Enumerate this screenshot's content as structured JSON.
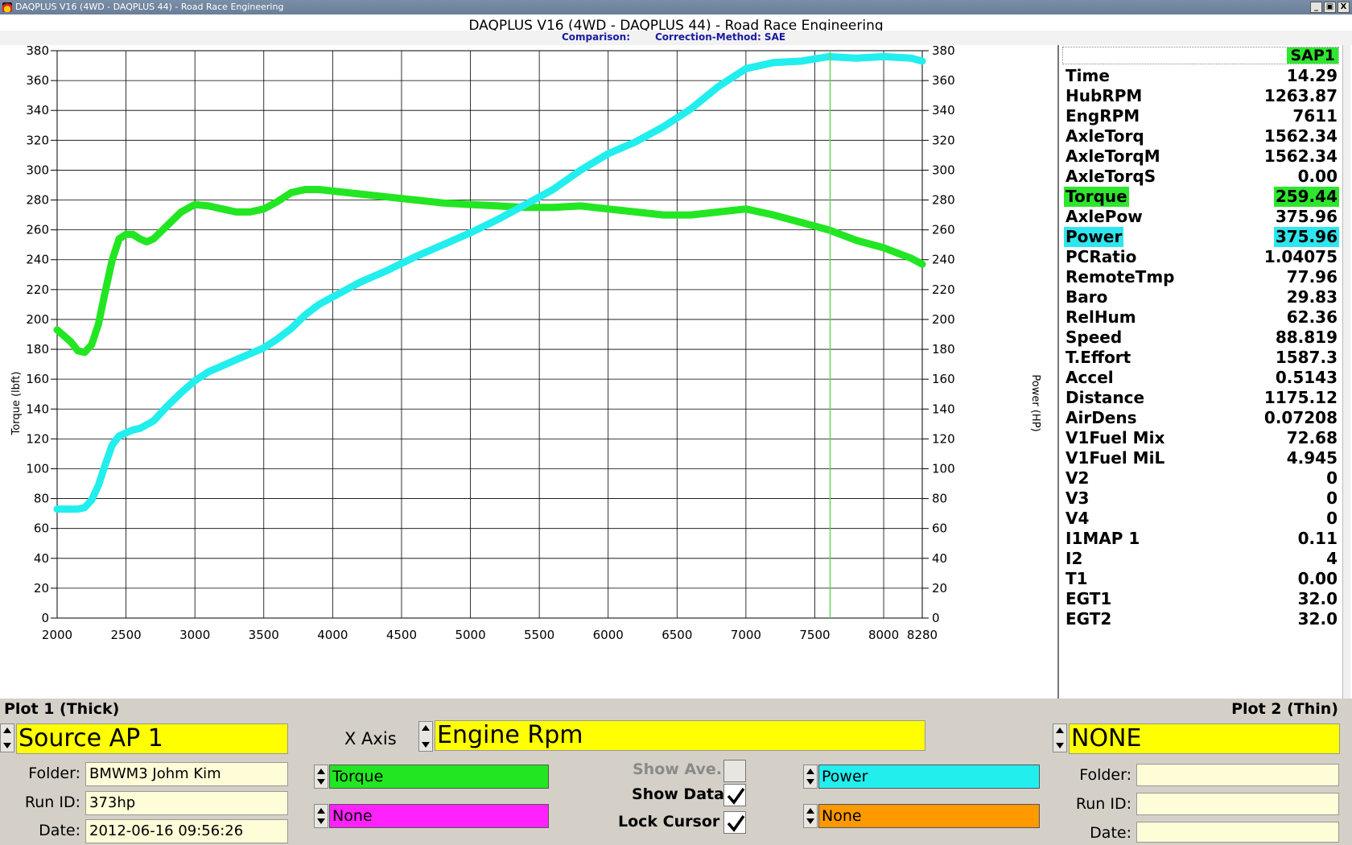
{
  "window": {
    "title": "DAQPLUS V16 (4WD - DAQPLUS 44) - Road Race Engineering",
    "minimize_label": "_",
    "restore_label": "▣",
    "close_label": "X"
  },
  "chart_header": {
    "title": "DAQPLUS V16 (4WD - DAQPLUS 44) - Road Race Engineering",
    "comparison_label": "Comparison:",
    "correction_label": "Correction-Method: SAE"
  },
  "chart_data": {
    "type": "line",
    "xlabel": "",
    "ylabel": "Torque (lbft)",
    "y2label": "Power (HP)",
    "xlim": [
      2000,
      8280
    ],
    "ylim": [
      0,
      380
    ],
    "y2lim": [
      0,
      380
    ],
    "x_ticks": [
      2000,
      2500,
      3000,
      3500,
      4000,
      4500,
      5000,
      5500,
      6000,
      6500,
      7000,
      7500,
      8000,
      8280
    ],
    "y_ticks": [
      0,
      20,
      40,
      60,
      80,
      100,
      120,
      140,
      160,
      180,
      200,
      220,
      240,
      260,
      280,
      300,
      320,
      340,
      360,
      380
    ],
    "grid": true,
    "cursor_x": 7611,
    "series": [
      {
        "name": "Torque",
        "color": "#22e622",
        "axis": "left",
        "x": [
          2000,
          2100,
          2150,
          2200,
          2250,
          2300,
          2350,
          2400,
          2450,
          2500,
          2550,
          2600,
          2650,
          2700,
          2800,
          2900,
          3000,
          3100,
          3200,
          3300,
          3400,
          3500,
          3600,
          3700,
          3800,
          3900,
          4000,
          4200,
          4400,
          4600,
          4800,
          5000,
          5200,
          5400,
          5600,
          5800,
          6000,
          6200,
          6400,
          6600,
          6800,
          7000,
          7200,
          7400,
          7600,
          7800,
          8000,
          8200,
          8280
        ],
        "values": [
          193,
          185,
          179,
          178,
          183,
          197,
          219,
          240,
          254,
          257,
          257,
          254,
          252,
          254,
          263,
          272,
          277,
          276,
          274,
          272,
          272,
          274,
          279,
          285,
          287,
          287,
          286,
          284,
          282,
          280,
          278,
          277,
          276,
          275,
          275,
          276,
          274,
          272,
          270,
          270,
          272,
          274,
          270,
          265,
          260,
          253,
          248,
          241,
          237
        ]
      },
      {
        "name": "Power",
        "color": "#22eeee",
        "axis": "right",
        "x": [
          2000,
          2100,
          2150,
          2200,
          2250,
          2300,
          2350,
          2400,
          2450,
          2500,
          2550,
          2600,
          2700,
          2800,
          2900,
          3000,
          3100,
          3200,
          3300,
          3400,
          3500,
          3600,
          3700,
          3800,
          3900,
          4000,
          4200,
          4400,
          4600,
          4800,
          5000,
          5200,
          5400,
          5600,
          5800,
          6000,
          6200,
          6400,
          6600,
          6800,
          7000,
          7200,
          7400,
          7600,
          7800,
          8000,
          8200,
          8280
        ],
        "values": [
          73,
          73,
          73,
          74,
          79,
          89,
          103,
          116,
          122,
          124,
          126,
          127,
          132,
          142,
          151,
          159,
          165,
          169,
          173,
          177,
          181,
          187,
          194,
          203,
          210,
          215,
          225,
          233,
          242,
          250,
          258,
          267,
          277,
          287,
          300,
          311,
          319,
          329,
          341,
          356,
          368,
          372,
          373,
          376,
          375,
          376,
          375,
          373
        ]
      }
    ]
  },
  "sidebar": {
    "run_name": "SAP1",
    "rows": [
      {
        "label": "Time",
        "value": "14.29"
      },
      {
        "label": "HubRPM",
        "value": "1263.87"
      },
      {
        "label": "EngRPM",
        "value": "7611"
      },
      {
        "label": "AxleTorq",
        "value": "1562.34"
      },
      {
        "label": "AxleTorqM",
        "value": "1562.34"
      },
      {
        "label": "AxleTorqS",
        "value": "0.00"
      },
      {
        "label": "Torque",
        "value": "259.44",
        "highlight": "#2ee62e"
      },
      {
        "label": "AxlePow",
        "value": "375.96"
      },
      {
        "label": "Power",
        "value": "375.96",
        "highlight": "#2ee6ee"
      },
      {
        "label": "PCRatio",
        "value": "1.04075"
      },
      {
        "label": "RemoteTmp",
        "value": "77.96"
      },
      {
        "label": "Baro",
        "value": "29.83"
      },
      {
        "label": "RelHum",
        "value": "62.36"
      },
      {
        "label": "Speed",
        "value": "88.819"
      },
      {
        "label": "T.Effort",
        "value": "1587.3"
      },
      {
        "label": "Accel",
        "value": "0.5143"
      },
      {
        "label": "Distance",
        "value": "1175.12"
      },
      {
        "label": "AirDens",
        "value": "0.07208"
      },
      {
        "label": "V1Fuel Mix",
        "value": "72.68"
      },
      {
        "label": "V1Fuel MiL",
        "value": "4.945"
      },
      {
        "label": "V2",
        "value": "0"
      },
      {
        "label": "V3",
        "value": "0"
      },
      {
        "label": "V4",
        "value": "0"
      },
      {
        "label": "I1MAP 1",
        "value": "0.11"
      },
      {
        "label": "I2",
        "value": "4"
      },
      {
        "label": "T1",
        "value": "0.00"
      },
      {
        "label": "EGT1",
        "value": "32.0"
      },
      {
        "label": "EGT2",
        "value": "32.0"
      }
    ]
  },
  "controls": {
    "plot1_label": "Plot 1 (Thick)",
    "plot2_label": "Plot 2 (Thin)",
    "source1": "Source AP 1",
    "source2": "NONE",
    "x_axis_label": "X Axis",
    "x_axis_value": "Engine Rpm",
    "folder_label": "Folder:",
    "runid_label": "Run ID:",
    "date_label": "Date:",
    "plot1_folder": "BMWM3 Johm Kim",
    "plot1_runid": "373hp",
    "plot1_date": "2012-06-16 09:56:26",
    "plot2_folder": "",
    "plot2_runid": "",
    "plot2_date": "",
    "channel_left_1": "Torque",
    "channel_left_1_color": "#22e622",
    "channel_left_2": "None",
    "channel_left_2_color": "#ff22ff",
    "channel_right_1": "Power",
    "channel_right_1_color": "#22eeee",
    "channel_right_2": "None",
    "channel_right_2_color": "#ff9900",
    "show_ave_label": "Show Ave.",
    "show_ave_checked": false,
    "show_data_label": "Show Data",
    "show_data_checked": true,
    "lock_cursor_label": "Lock Cursor",
    "lock_cursor_checked": true
  }
}
